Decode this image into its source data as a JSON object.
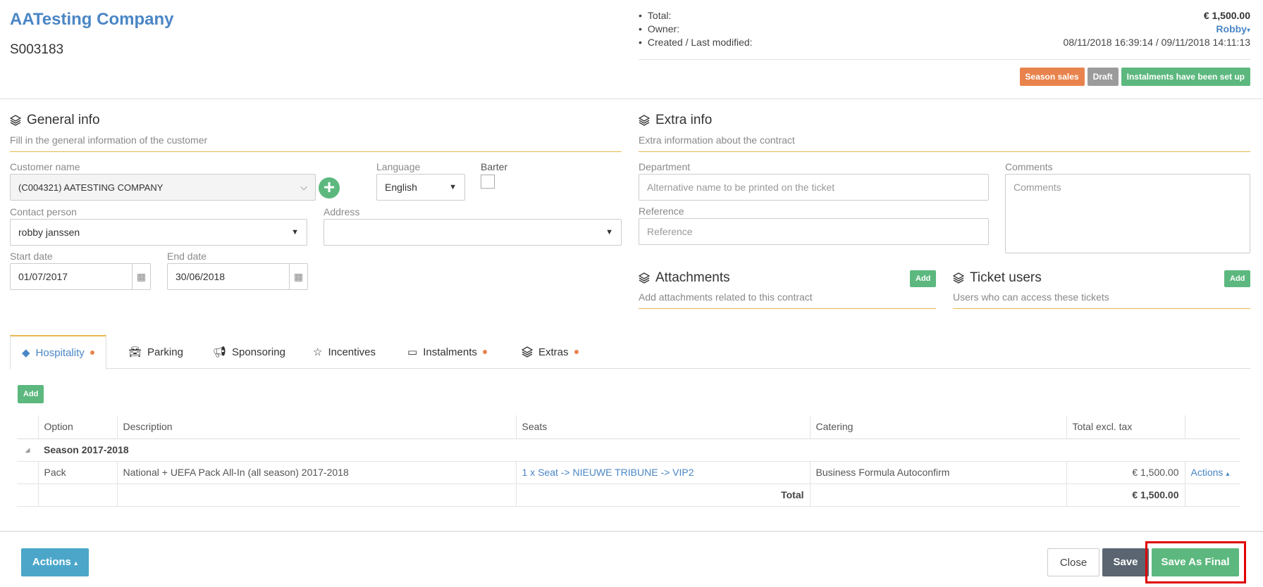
{
  "header": {
    "company_name": "AATesting Company",
    "contract_number": "S003183",
    "meta": {
      "total_label": "Total:",
      "total_value": "€ 1,500.00",
      "owner_label": "Owner:",
      "owner_value": "Robby",
      "created_label": "Created / Last modified:",
      "created_value": "08/11/2018 16:39:14 / 09/11/2018 14:11:13"
    },
    "badges": [
      "Season sales",
      "Draft",
      "Instalments have been set up"
    ]
  },
  "general_info": {
    "title": "General info",
    "subtitle": "Fill in the general information of the customer",
    "customer_name_label": "Customer name",
    "customer_name_value": "(C004321) AATESTING COMPANY",
    "language_label": "Language",
    "language_value": "English",
    "barter_label": "Barter",
    "contact_label": "Contact person",
    "contact_value": "robby janssen",
    "address_label": "Address",
    "address_value": "",
    "start_label": "Start date",
    "start_value": "01/07/2017",
    "end_label": "End date",
    "end_value": "30/06/2018"
  },
  "extra_info": {
    "title": "Extra info",
    "subtitle": "Extra information about the contract",
    "department_label": "Department",
    "department_placeholder": "Alternative name to be printed on the ticket",
    "reference_label": "Reference",
    "reference_placeholder": "Reference",
    "comments_label": "Comments",
    "comments_placeholder": "Comments"
  },
  "attachments": {
    "title": "Attachments",
    "subtitle": "Add attachments related to this contract",
    "add_label": "Add"
  },
  "ticket_users": {
    "title": "Ticket users",
    "subtitle": "Users who can access these tickets",
    "add_label": "Add"
  },
  "tabs": [
    {
      "label": "Hospitality",
      "dot": true
    },
    {
      "label": "Parking",
      "dot": false
    },
    {
      "label": "Sponsoring",
      "dot": false
    },
    {
      "label": "Incentives",
      "dot": false
    },
    {
      "label": "Instalments",
      "dot": true
    },
    {
      "label": "Extras",
      "dot": true
    }
  ],
  "table": {
    "add_label": "Add",
    "columns": [
      "Option",
      "Description",
      "Seats",
      "Catering",
      "Total excl. tax"
    ],
    "group": "Season 2017-2018",
    "rows": [
      {
        "option": "Pack",
        "description": "National + UEFA Pack All-In (all season) 2017-2018",
        "seats": "1 x Seat -> NIEUWE TRIBUNE -> VIP2",
        "catering": "Business Formula Autoconfirm",
        "total": "€ 1,500.00",
        "actions": "Actions"
      }
    ],
    "total_label": "Total",
    "total_value": "€ 1,500.00"
  },
  "footer": {
    "actions_label": "Actions",
    "close_label": "Close",
    "save_label": "Save",
    "save_final_label": "Save As Final"
  },
  "colors": {
    "brand_blue": "#4a86c5",
    "green": "#5cb87e",
    "orange": "#e9834d",
    "accent_line": "#e8b94d",
    "highlight": "#e00000"
  }
}
